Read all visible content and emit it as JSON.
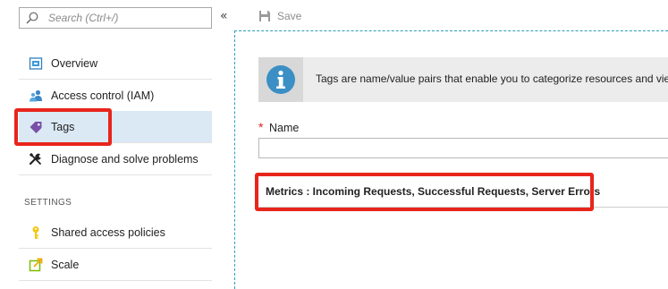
{
  "search": {
    "placeholder": "Search (Ctrl+/)",
    "collapse_glyph": "«"
  },
  "sidebar": {
    "items": [
      {
        "label": "Overview",
        "icon": "overview-icon",
        "selected": false
      },
      {
        "label": "Access control (IAM)",
        "icon": "people-icon",
        "selected": false
      },
      {
        "label": "Tags",
        "icon": "tag-icon",
        "selected": true
      },
      {
        "label": "Diagnose and solve problems",
        "icon": "wrench-icon",
        "selected": false
      }
    ],
    "settings_header": "SETTINGS",
    "settings_items": [
      {
        "label": "Shared access policies",
        "icon": "key-icon"
      },
      {
        "label": "Scale",
        "icon": "scale-icon"
      }
    ]
  },
  "toolbar": {
    "save_label": "Save"
  },
  "banner": {
    "text": "Tags are name/value pairs that enable you to categorize resources and view"
  },
  "form": {
    "required_mark": "*",
    "name_label": "Name",
    "name_value": "",
    "metrics_text": "Metrics : Incoming Requests, Successful Requests, Server Errors"
  },
  "colors": {
    "highlight_border": "#e8251b",
    "selected_bg": "#dbe9f5",
    "divider_accent": "#2a9fb6",
    "tag_icon": "#7a4fa8",
    "info_icon": "#3b8fc4"
  }
}
